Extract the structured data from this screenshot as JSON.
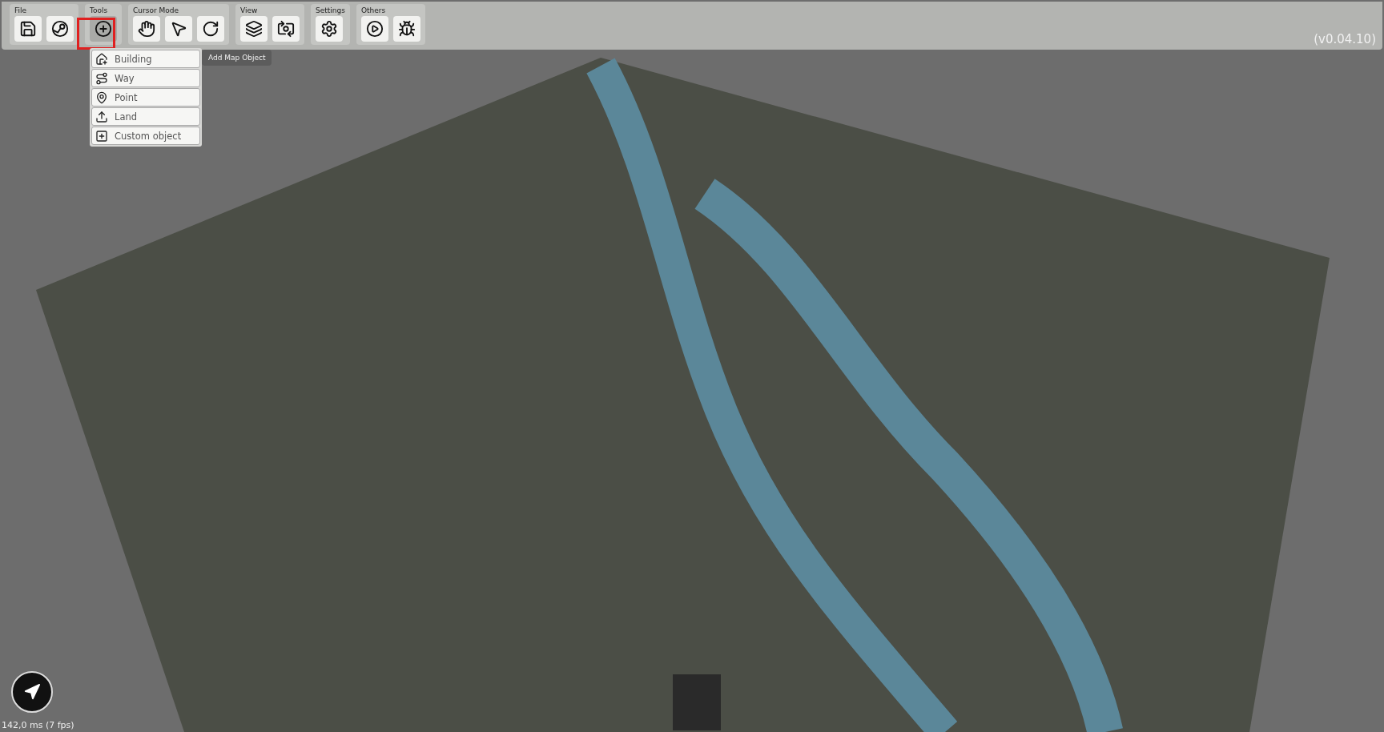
{
  "toolbar": {
    "groups": [
      {
        "label": "File",
        "buttons": [
          {
            "kind": "save",
            "selected": false
          },
          {
            "kind": "steam",
            "selected": false
          }
        ]
      },
      {
        "label": "Tools",
        "buttons": [
          {
            "kind": "add",
            "selected": true
          }
        ]
      },
      {
        "label": "Cursor Mode",
        "buttons": [
          {
            "kind": "hand",
            "selected": false
          },
          {
            "kind": "pointer",
            "selected": false
          },
          {
            "kind": "rotate",
            "selected": false
          }
        ]
      },
      {
        "label": "View",
        "buttons": [
          {
            "kind": "layers",
            "selected": false
          },
          {
            "kind": "camera",
            "selected": false
          }
        ]
      },
      {
        "label": "Settings",
        "buttons": [
          {
            "kind": "settings",
            "selected": false
          }
        ]
      },
      {
        "label": "Others",
        "buttons": [
          {
            "kind": "play",
            "selected": false
          },
          {
            "kind": "bug",
            "selected": false
          }
        ]
      }
    ],
    "version": "(v0.04.10)"
  },
  "tooltip": "Add Map Object",
  "add_menu": [
    {
      "kind": "building",
      "label": "Building"
    },
    {
      "kind": "way",
      "label": "Way"
    },
    {
      "kind": "point",
      "label": "Point"
    },
    {
      "kind": "land",
      "label": "Land"
    },
    {
      "kind": "custom",
      "label": "Custom object"
    }
  ],
  "status": "142,0 ms (7 fps)"
}
